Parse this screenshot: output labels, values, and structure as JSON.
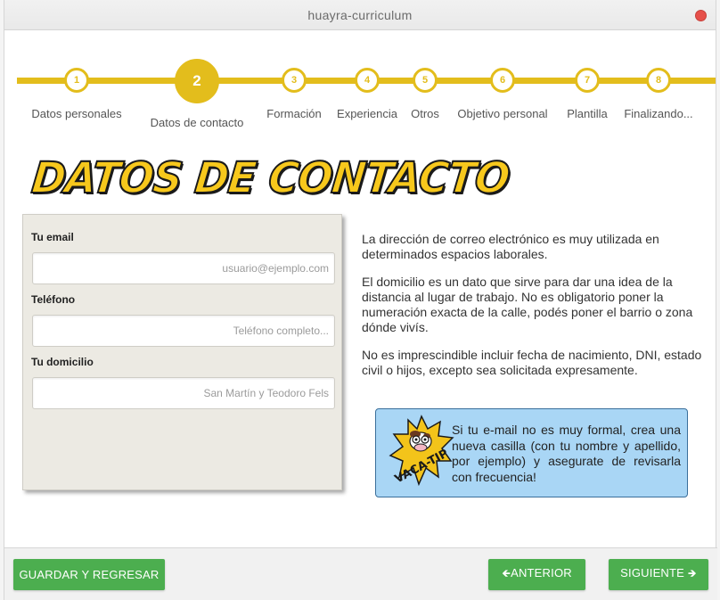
{
  "window": {
    "title": "huayra-curriculum"
  },
  "stepper": {
    "steps": [
      {
        "number": "1",
        "label": "Datos personales"
      },
      {
        "number": "2",
        "label": "Datos de contacto"
      },
      {
        "number": "3",
        "label": "Formación"
      },
      {
        "number": "4",
        "label": "Experiencia"
      },
      {
        "number": "5",
        "label": "Otros"
      },
      {
        "number": "6",
        "label": "Objetivo personal"
      },
      {
        "number": "7",
        "label": "Plantilla"
      },
      {
        "number": "8",
        "label": "Finalizando..."
      }
    ],
    "active_step": 2
  },
  "page": {
    "title": "DATOS DE CONTACTO"
  },
  "form": {
    "email": {
      "label": "Tu email",
      "value": "",
      "placeholder": "usuario@ejemplo.com"
    },
    "phone": {
      "label": "Teléfono",
      "value": "",
      "placeholder": "Teléfono completo..."
    },
    "address": {
      "label": "Tu domicilio",
      "value": "",
      "placeholder": "San Martín y Teodoro Fels"
    }
  },
  "info": {
    "paragraphs": [
      "La dirección de correo electrónico es muy utilizada en determinados espacios laborales.",
      "El domicilio es un dato que sirve para dar una idea de la distancia al lugar de trabajo. No es obligatorio poner la numeración exacta de la calle, podés poner el barrio o zona dónde vivís.",
      "No es imprescindible incluir fecha de nacimiento, DNI, estado civil o hijos, excepto sea solicitada expresamente."
    ]
  },
  "tip": {
    "badge_text": "VACA-TIP",
    "text": "Si tu e-mail no es muy formal, crea una nueva casilla (con tu nombre y apellido, por ejemplo) y asegurate de revisarla con frecuencia!"
  },
  "footer": {
    "save_label": "GUARDAR Y REGRESAR",
    "prev_label": "ANTERIOR",
    "next_label": "SIGUIENTE"
  },
  "colors": {
    "accent_yellow": "#e3bd1c",
    "button_green": "#4cae4f",
    "tip_blue": "#a9d6f5",
    "card_bg": "#eceae3"
  }
}
